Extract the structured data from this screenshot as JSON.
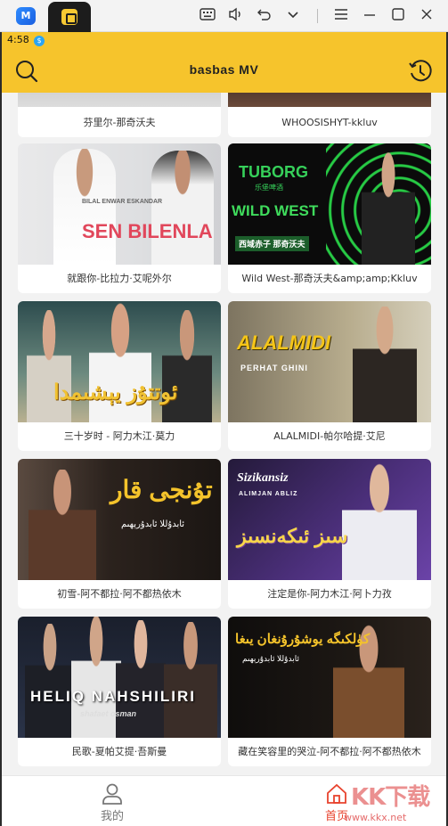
{
  "emulator": {
    "logo_glyph": "M",
    "controls": [
      "keyboard-icon",
      "volume-icon",
      "undo-icon",
      "chevron-down-icon",
      "menu-icon",
      "minimize-icon",
      "maximize-icon",
      "close-icon"
    ]
  },
  "status_bar": {
    "time": "4:58",
    "badge": "$"
  },
  "header": {
    "title": "basbas  MV"
  },
  "colors": {
    "accent": "#f6c42c",
    "nav_active": "#e8432e",
    "nav_inactive": "#777777"
  },
  "videos": [
    {
      "title": "芬里尔-那奇沃夫"
    },
    {
      "title": "WHOOSISHYT-kkluv"
    },
    {
      "title": "就跟你-比拉力·艾呢外尔",
      "overlay": {
        "names": "BILAL ENWAR        ESKANDAR",
        "headline": "SEN BILENLA"
      }
    },
    {
      "title": "Wild West-那奇沃夫&amp;amp;Kkluv",
      "overlay": {
        "brand": "TUBORG",
        "brand_sub": "乐堡啤酒",
        "headline": "WILD WEST",
        "tag": "西域赤子 那奇沃夫"
      }
    },
    {
      "title": "三十岁时 - 阿力木江·莫力",
      "overlay": {
        "headline": "ئوتتۇز يېشىمدا"
      }
    },
    {
      "title": "ALALMIDI-帕尔哈提·艾尼",
      "overlay": {
        "headline": "ALALMIDI",
        "sub": "PERHAT GHINI"
      }
    },
    {
      "title": "初雪-阿不都拉·阿不都热依木",
      "overlay": {
        "headline": "تۇنجى قار",
        "sub": "ئابدۇللا ئابدۇرېھىم"
      }
    },
    {
      "title": "注定是你-阿力木江·阿卜力孜",
      "overlay": {
        "headline": "Sizikansiz",
        "sub": "ALIMJAN ABLIZ",
        "script": "سىز ئىكەنسىز"
      }
    },
    {
      "title": "民歌-夏帕艾提·吾斯曼",
      "overlay": {
        "headline": "HELIQ NAHSHILIRI",
        "sub": "shafaet osman"
      }
    },
    {
      "title": "藏在笑容里的哭泣-阿不都拉·阿不都热依木",
      "overlay": {
        "headline": "كۈلكىگە يوشۇرۇنغان يىغا",
        "sub": "ئابدۇللا ئابدۇرېھىم"
      }
    }
  ],
  "bottom_nav": [
    {
      "label": "我的"
    },
    {
      "label": "首页"
    }
  ],
  "watermark": {
    "text": "KK下载",
    "url": "www.kkx.net"
  }
}
